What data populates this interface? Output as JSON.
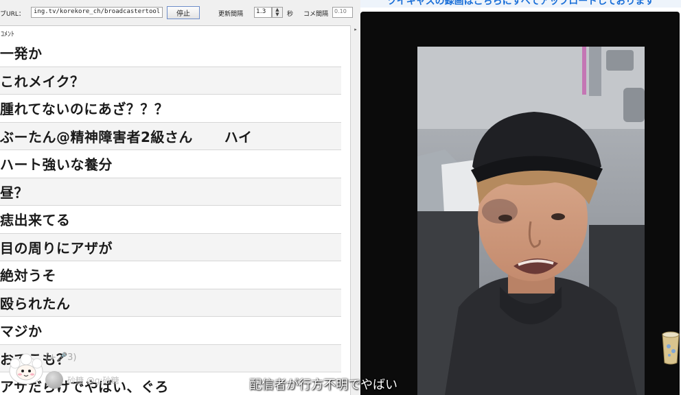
{
  "banner": {
    "text": "ツイキャスの録画はこちらにすべてアップロードしております"
  },
  "toolbar": {
    "url_label": "ブURL：",
    "url_value": "ing.tv/korekore_ch/broadcastertool",
    "stop_label": "停止",
    "interval_label": "更新間隔",
    "interval_value": "1.3",
    "seconds_label": "秒",
    "comment_interval_label": "コメ間隔",
    "comment_interval_value": "0.10"
  },
  "comments": {
    "header": "ｺﾒﾝﾄ",
    "rows": [
      {
        "text": "一発か"
      },
      {
        "text": "これメイク？"
      },
      {
        "text": "腫れてないのにあざ？？？"
      },
      {
        "text": "ぶーたん@精神障害者2級さん",
        "extra": "ハイ"
      },
      {
        "text": "ハート強いな養分"
      },
      {
        "text": "昼？"
      },
      {
        "text": "痣出来てる"
      },
      {
        "text": "目の周りにアザが"
      },
      {
        "text": "絶対うそ"
      },
      {
        "text": "殴られたん"
      },
      {
        "text": "マジか"
      },
      {
        "text": "おでこも？"
      },
      {
        "text": "アザだらけでやばい、ぐろ"
      }
    ]
  },
  "overlay": {
    "reaction_count": "(+🎤3)",
    "user_name": "砂糖 @g:砂糖"
  },
  "video": {
    "subtitle": "配信者が行方不明でやばい"
  },
  "colors": {
    "banner_text": "#1a6fd8",
    "video_background": "#0b0b0b",
    "row_border": "#d6d6d6"
  },
  "icons": {
    "mascot": "sheep-mascot-icon",
    "side_widget": "drink-cup-icon"
  }
}
